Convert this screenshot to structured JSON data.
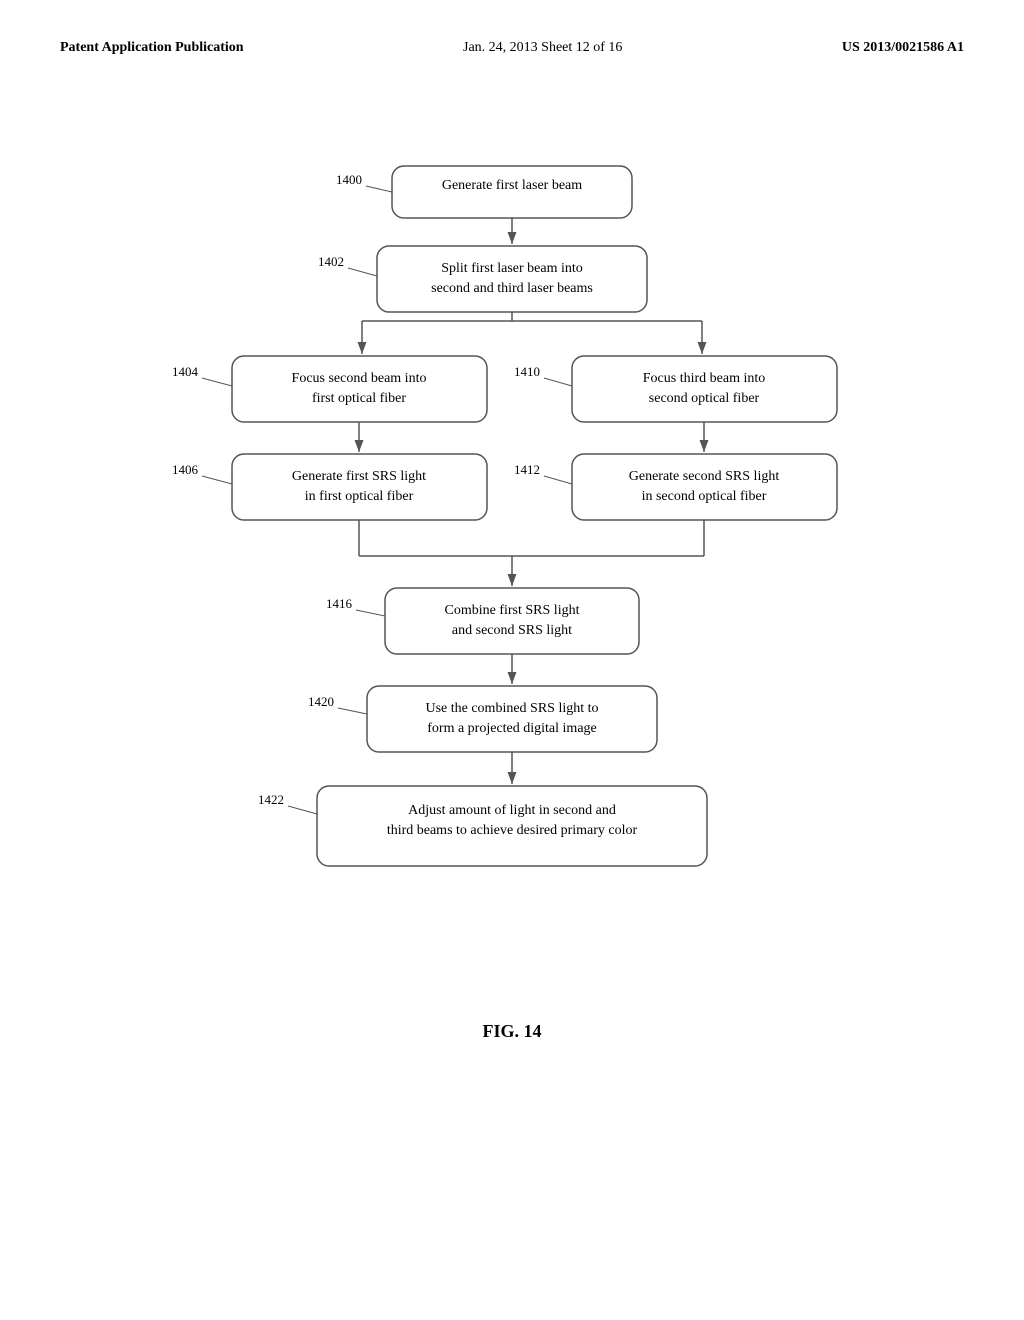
{
  "header": {
    "left_label": "Patent Application Publication",
    "center_label": "Jan. 24, 2013  Sheet 12 of 16",
    "right_label": "US 2013/0021586 A1"
  },
  "figure": {
    "caption": "FIG. 14",
    "nodes": [
      {
        "id": "1400",
        "label": "1400",
        "text": "Generate first laser beam"
      },
      {
        "id": "1402",
        "label": "1402",
        "text": "Split first laser beam into\nsecond and third laser beams"
      },
      {
        "id": "1404",
        "label": "1404",
        "text": "Focus second beam into\nfirst optical fiber"
      },
      {
        "id": "1410",
        "label": "1410",
        "text": "Focus third beam into\nsecond optical fiber"
      },
      {
        "id": "1406",
        "label": "1406",
        "text": "Generate first SRS light\nin first optical fiber"
      },
      {
        "id": "1412",
        "label": "1412",
        "text": "Generate second SRS light\nin second optical fiber"
      },
      {
        "id": "1416",
        "label": "1416",
        "text": "Combine first SRS light\nand second SRS light"
      },
      {
        "id": "1420",
        "label": "1420",
        "text": "Use the combined SRS light to\nform a projected digital image"
      },
      {
        "id": "1422",
        "label": "1422",
        "text": "Adjust amount of light in second and\nthird beams to achieve desired primary color"
      }
    ]
  }
}
